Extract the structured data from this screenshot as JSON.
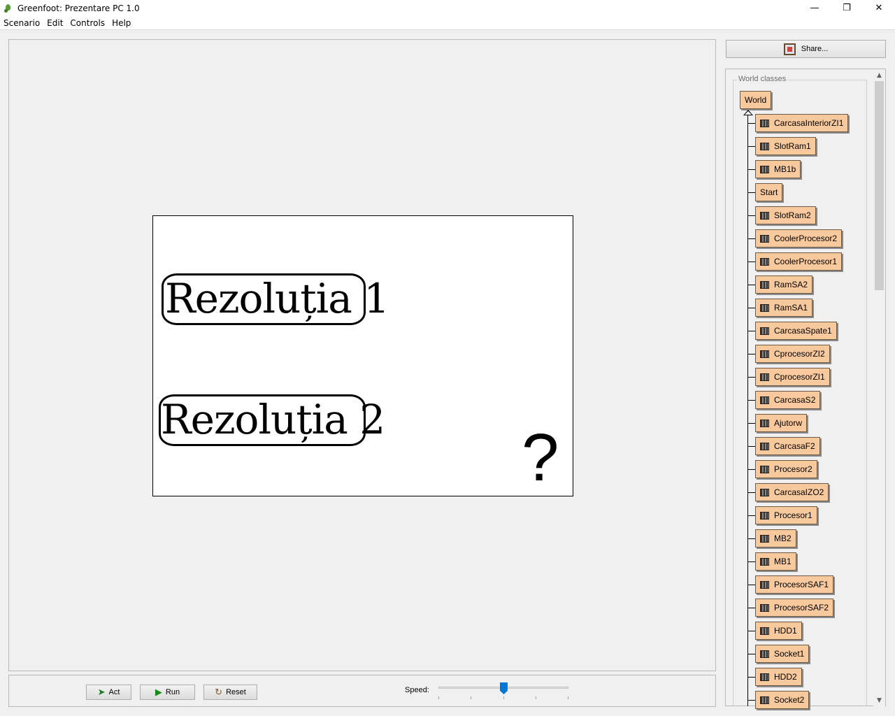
{
  "window": {
    "title": "Greenfoot: Prezentare PC 1.0",
    "minimize": "—",
    "restore": "❐",
    "close": "✕"
  },
  "menu": [
    "Scenario",
    "Edit",
    "Controls",
    "Help"
  ],
  "world": {
    "buttons": [
      "Rezoluția 1",
      "Rezoluția 2"
    ],
    "help_glyph": "?"
  },
  "controls": {
    "act_label": "Act",
    "run_label": "Run",
    "reset_label": "Reset",
    "speed_label": "Speed:",
    "speed_value": 0.5
  },
  "share": {
    "label": "Share..."
  },
  "classes": {
    "group_label": "World classes",
    "root": "World",
    "subclasses": [
      "CarcasaInteriorZI1",
      "SlotRam1",
      "MB1b",
      "Start",
      "SlotRam2",
      "CoolerProcesor2",
      "CoolerProcesor1",
      "RamSA2",
      "RamSA1",
      "CarcasaSpate1",
      "CprocesorZI2",
      "CprocesorZI1",
      "CarcasaS2",
      "Ajutorw",
      "CarcasaF2",
      "Procesor2",
      "CarcasaIZO2",
      "Procesor1",
      "MB2",
      "MB1",
      "ProcesorSAF1",
      "ProcesorSAF2",
      "HDD1",
      "Socket1",
      "HDD2",
      "Socket2"
    ],
    "no_thumb": [
      "Start"
    ]
  },
  "colors": {
    "class_fill": "#f7c99c",
    "accent": "#0078d7"
  }
}
